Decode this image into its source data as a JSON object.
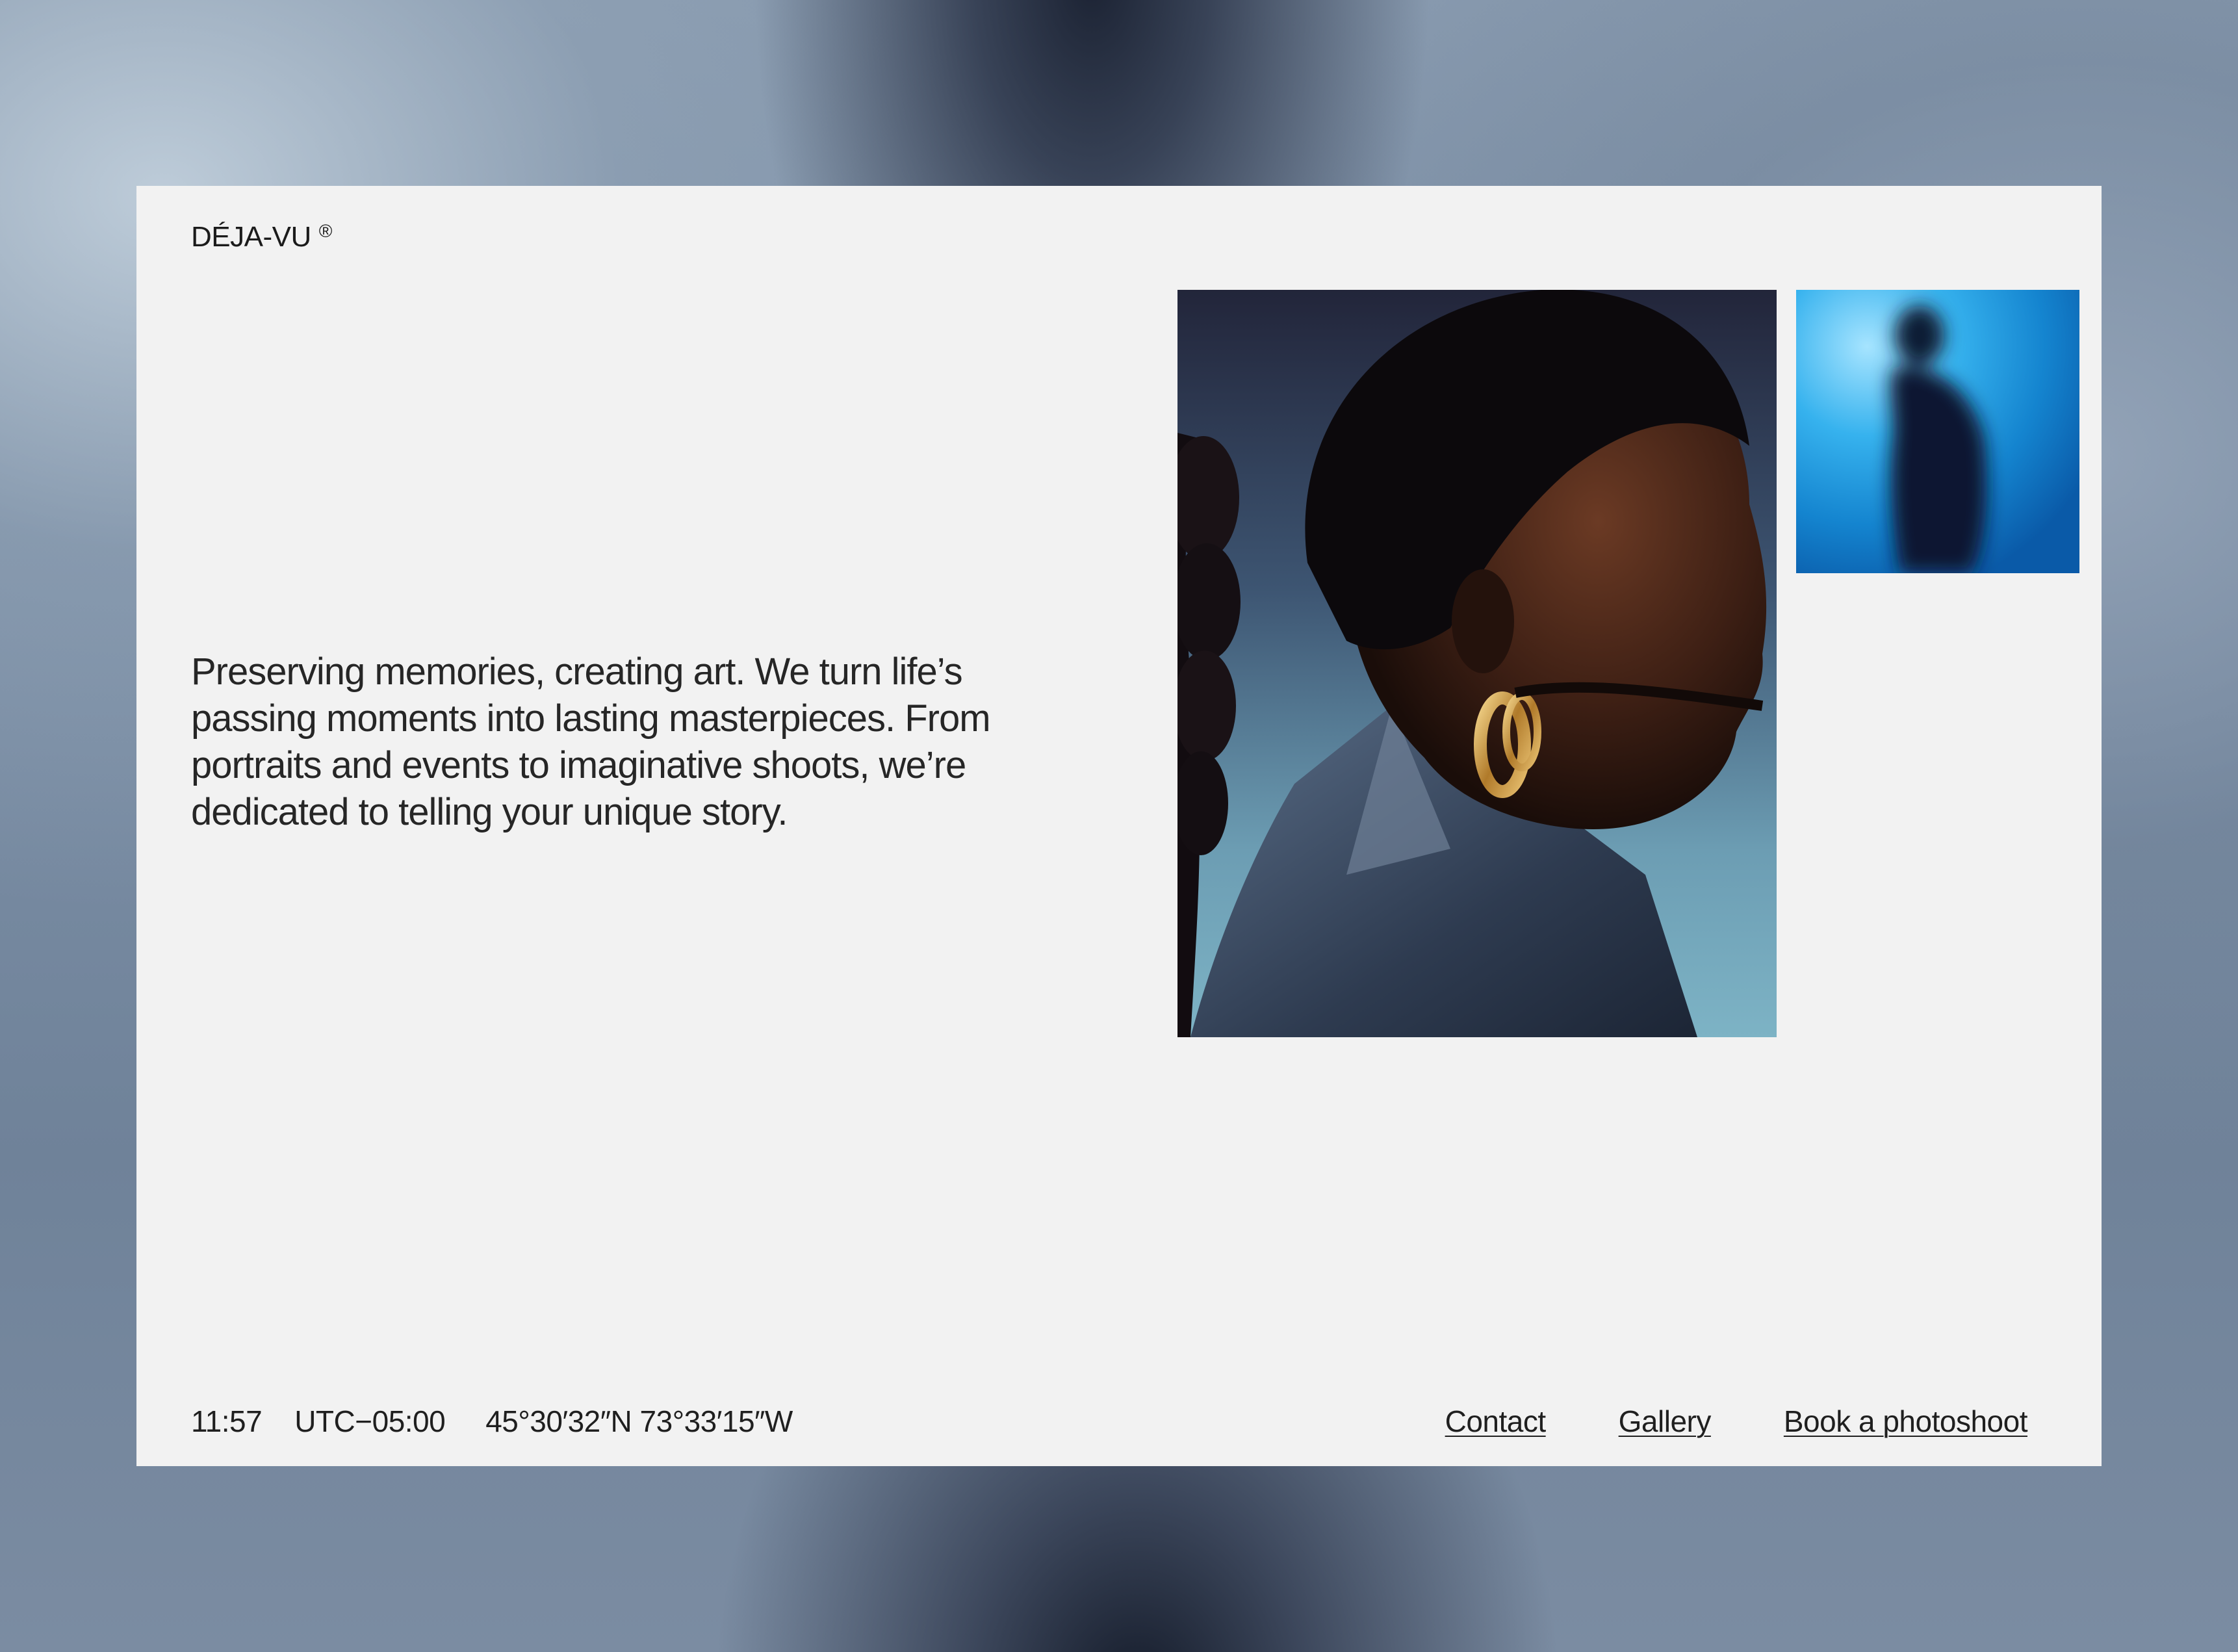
{
  "brand": {
    "name": "DÉJA-VU",
    "mark": "®"
  },
  "hero": {
    "tagline": "Preserving memories, creating art. We turn life’s passing moments into lasting masterpieces. From portraits and events to imaginative shoots, we’re dedicated to telling your unique story."
  },
  "images": {
    "main": "portrait-profile-photo",
    "secondary": "blurred-silhouette-photo"
  },
  "footer": {
    "time": "11:57",
    "timezone": "UTC−05:00",
    "coordinates": "45°30′32″N 73°33′15″W",
    "links": {
      "contact": "Contact",
      "gallery": "Gallery",
      "book": "Book a photoshoot"
    }
  },
  "colors": {
    "card": "#f2f2f2",
    "text": "#1f1f1f"
  }
}
